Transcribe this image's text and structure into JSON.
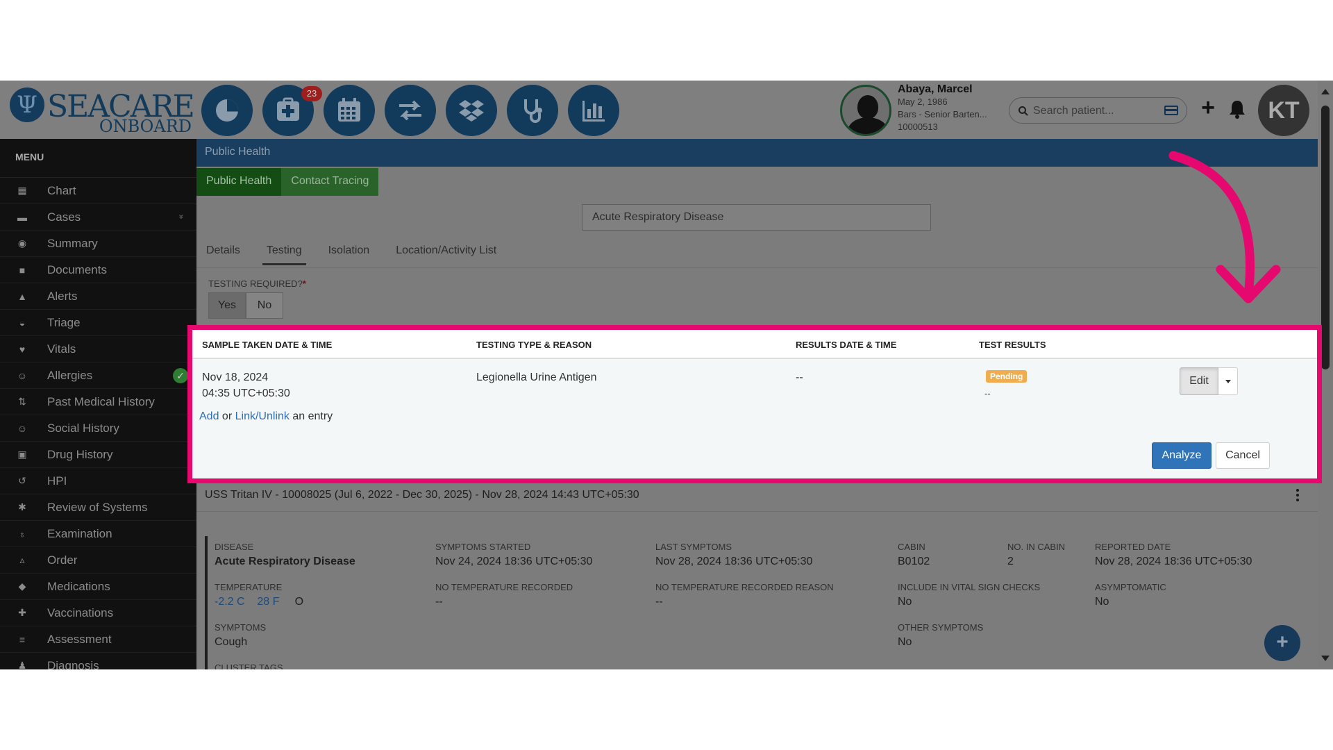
{
  "app": {
    "logo_main": "SEACARE",
    "logo_sub": "ONBOARD",
    "nav_icons": [
      "pie-chart-icon",
      "medical-plus-icon",
      "calendar-icon",
      "transfer-arrows-icon",
      "dropbox-icon",
      "stethoscope-icon",
      "bar-chart-icon"
    ],
    "notification_count": "23"
  },
  "patient": {
    "name": "Abaya, Marcel",
    "dob": "May 2, 1986",
    "role": "Bars - Senior Barten...",
    "id": "10000513"
  },
  "search": {
    "placeholder": "Search patient..."
  },
  "user": {
    "initials": "KT"
  },
  "sidebar": {
    "title": "MENU",
    "items": [
      {
        "label": "Chart",
        "icon": "bar-chart-icon",
        "glyph": "▦"
      },
      {
        "label": "Cases",
        "icon": "archive-icon",
        "glyph": "▬",
        "chevron": "»"
      },
      {
        "label": "Summary",
        "icon": "eye-icon",
        "glyph": "◉"
      },
      {
        "label": "Documents",
        "icon": "folder-icon",
        "glyph": "■"
      },
      {
        "label": "Alerts",
        "icon": "warning-icon",
        "glyph": "▲"
      },
      {
        "label": "Triage",
        "icon": "inbox-icon",
        "glyph": "◒"
      },
      {
        "label": "Vitals",
        "icon": "heart-icon",
        "glyph": "♥"
      },
      {
        "label": "Allergies",
        "icon": "smile-icon",
        "glyph": "☺",
        "check": "✓"
      },
      {
        "label": "Past Medical History",
        "icon": "sort-icon",
        "glyph": "⇅"
      },
      {
        "label": "Social History",
        "icon": "smile-icon",
        "glyph": "☺"
      },
      {
        "label": "Drug History",
        "icon": "briefcase-medical-icon",
        "glyph": "▣"
      },
      {
        "label": "HPI",
        "icon": "history-icon",
        "glyph": "↺"
      },
      {
        "label": "Review of Systems",
        "icon": "gear-icon",
        "glyph": "✱"
      },
      {
        "label": "Examination",
        "icon": "stethoscope-icon",
        "glyph": "♁"
      },
      {
        "label": "Order",
        "icon": "flask-icon",
        "glyph": "▵"
      },
      {
        "label": "Medications",
        "icon": "pills-icon",
        "glyph": "◆"
      },
      {
        "label": "Vaccinations",
        "icon": "plus-square-icon",
        "glyph": "✚"
      },
      {
        "label": "Assessment",
        "icon": "list-icon",
        "glyph": "≡"
      },
      {
        "label": "Diagnosis",
        "icon": "user-md-icon",
        "glyph": "♟"
      }
    ]
  },
  "section": {
    "header": "Public Health",
    "tabs": [
      "Public Health",
      "Contact Tracing"
    ],
    "disease": "Acute Respiratory Disease",
    "sub_tabs": [
      "Details",
      "Testing",
      "Isolation",
      "Location/Activity List"
    ],
    "active_sub_tab": "Testing",
    "testing_required_label": "TESTING REQUIRED?",
    "required_marker": "*",
    "yes": "Yes",
    "no": "No",
    "selected": "Yes"
  },
  "testing_table": {
    "headers": [
      "SAMPLE TAKEN DATE & TIME",
      "TESTING TYPE & REASON",
      "RESULTS DATE & TIME",
      "TEST RESULTS"
    ],
    "row": {
      "sample_date": "Nov 18, 2024",
      "sample_time": "04:35 UTC+05:30",
      "testing_type": "Legionella Urine Antigen",
      "results_date": "--",
      "status": "Pending",
      "result": "--",
      "edit_label": "Edit"
    },
    "add_link": "Add",
    "or_text": "or",
    "link_unlink": "Link/Unlink",
    "entry_text": "an entry",
    "analyze_label": "Analyze",
    "cancel_label": "Cancel"
  },
  "case": {
    "title": "USS Tritan IV - 10008025 (Jul 6, 2022 - Dec 30, 2025) - Nov 28, 2024 14:43 UTC+05:30",
    "disease_label": "DISEASE",
    "disease": "Acute Respiratory Disease",
    "symptoms_started_label": "SYMPTOMS STARTED",
    "symptoms_started": "Nov 24, 2024 18:36 UTC+05:30",
    "last_symptoms_label": "LAST SYMPTOMS",
    "last_symptoms": "Nov 28, 2024 18:36 UTC+05:30",
    "cabin_label": "CABIN",
    "cabin": "B0102",
    "no_in_cabin_label": "NO. IN CABIN",
    "no_in_cabin": "2",
    "reported_date_label": "REPORTED DATE",
    "reported_date": "Nov 28, 2024 18:36 UTC+05:30",
    "temperature_label": "TEMPERATURE",
    "temp_c": "-2.2 C",
    "temp_f": "28 F",
    "temp_o": "O",
    "no_temp_label": "NO TEMPERATURE RECORDED",
    "no_temp": "--",
    "no_temp_reason_label": "NO TEMPERATURE RECORDED REASON",
    "no_temp_reason": "--",
    "include_vitals_label": "INCLUDE IN VITAL SIGN CHECKS",
    "include_vitals": "No",
    "asymptomatic_label": "ASYMPTOMATIC",
    "asymptomatic": "No",
    "symptoms_label": "SYMPTOMS",
    "symptoms": "Cough",
    "other_symptoms_label": "OTHER SYMPTOMS",
    "other_symptoms": "No",
    "cluster_tags_label": "CLUSTER TAGS"
  },
  "colors": {
    "highlight": "#e5086e",
    "primary": "#2f73b8",
    "pending": "#f0ad4e",
    "nav_button": "#113a5b"
  }
}
